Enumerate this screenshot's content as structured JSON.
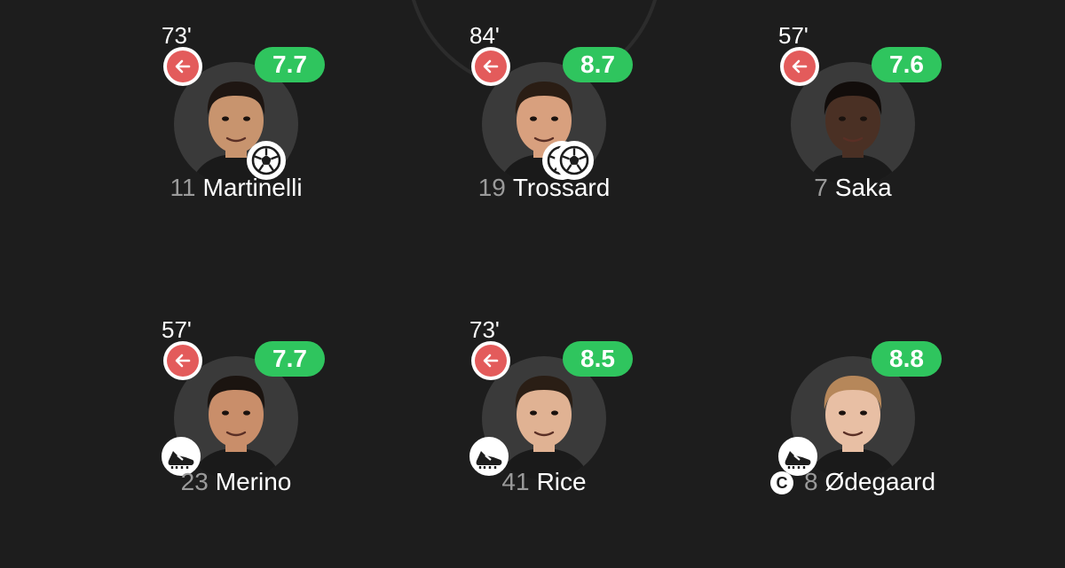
{
  "players": [
    {
      "id": "martinelli",
      "number": "11",
      "name": "Martinelli",
      "sub_time": "73'",
      "rating": "7.7",
      "subbed_off": true,
      "events": [
        "goal"
      ],
      "captain": false,
      "skin": "#c8946e",
      "hair": "#1e1612",
      "shirt": "#1a1a1a"
    },
    {
      "id": "trossard",
      "number": "19",
      "name": "Trossard",
      "sub_time": "84'",
      "rating": "8.7",
      "subbed_off": true,
      "events": [
        "goal",
        "goal"
      ],
      "captain": false,
      "skin": "#d8a07e",
      "hair": "#2a1d14",
      "shirt": "#1a1a1a"
    },
    {
      "id": "saka",
      "number": "7",
      "name": "Saka",
      "sub_time": "57'",
      "rating": "7.6",
      "subbed_off": true,
      "events": [],
      "captain": false,
      "skin": "#4a3024",
      "hair": "#120d0b",
      "shirt": "#1a1a1a"
    },
    {
      "id": "merino",
      "number": "23",
      "name": "Merino",
      "sub_time": "57'",
      "rating": "7.7",
      "subbed_off": true,
      "events": [
        "assist"
      ],
      "captain": false,
      "skin": "#c98e6a",
      "hair": "#1b1410",
      "shirt": "#1a1a1a"
    },
    {
      "id": "rice",
      "number": "41",
      "name": "Rice",
      "sub_time": "73'",
      "rating": "8.5",
      "subbed_off": true,
      "events": [
        "assist"
      ],
      "captain": false,
      "skin": "#e0b293",
      "hair": "#2a1e15",
      "shirt": "#1a1a1a"
    },
    {
      "id": "odegaard",
      "number": "8",
      "name": "Ødegaard",
      "sub_time": "",
      "rating": "8.8",
      "subbed_off": false,
      "events": [
        "assist"
      ],
      "captain": true,
      "captain_label": "C",
      "skin": "#e8bfa4",
      "hair": "#b6875a",
      "shirt": "#1a1a1a"
    }
  ],
  "colors": {
    "background": "#1d1d1d",
    "rating_bg": "#2fc55e",
    "sub_off": "#e35b5b",
    "circle": "#3a3a3a",
    "number": "#9a9a9a"
  }
}
